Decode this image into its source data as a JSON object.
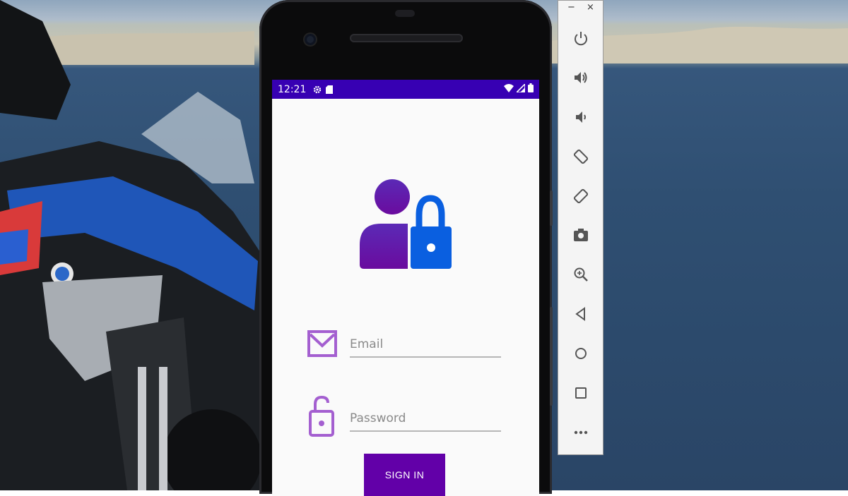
{
  "statusbar": {
    "time": "12:21",
    "icons": [
      "gear-icon",
      "sd-card-icon",
      "wifi-icon",
      "signal-icon",
      "battery-icon"
    ]
  },
  "login": {
    "email_placeholder": "Email",
    "password_placeholder": "Password",
    "signin_label": "SIGN IN"
  },
  "emulator_toolbar": {
    "window_controls": [
      "−",
      "×"
    ],
    "tools": [
      "power-icon",
      "volume-up-icon",
      "volume-down-icon",
      "rotate-left-icon",
      "rotate-right-icon",
      "camera-icon",
      "zoom-icon",
      "back-icon",
      "home-icon",
      "overview-icon",
      "more-icon"
    ]
  },
  "colors": {
    "statusbar": "#3700b3",
    "primary": "#6200a8",
    "field_icon": "#a45fd0",
    "lock_blue": "#0a5fe0"
  }
}
